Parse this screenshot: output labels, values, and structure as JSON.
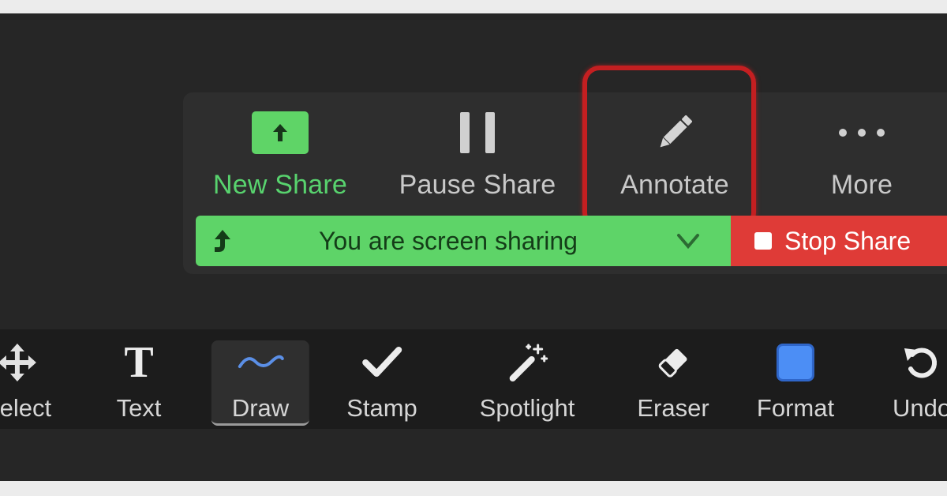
{
  "share_toolbar": {
    "items": [
      {
        "label": "New Share",
        "icon": "share-arrow-up-icon"
      },
      {
        "label": "Pause Share",
        "icon": "pause-icon"
      },
      {
        "label": "Annotate",
        "icon": "pencil-icon"
      },
      {
        "label": "More",
        "icon": "more-dots-icon"
      }
    ],
    "status_text": "You are screen sharing",
    "stop_label": "Stop Share"
  },
  "annotation_toolbar": {
    "tools": [
      {
        "label": "Select",
        "icon": "move-arrows-icon"
      },
      {
        "label": "Text",
        "icon": "text-t-icon"
      },
      {
        "label": "Draw",
        "icon": "squiggle-line-icon",
        "selected": true
      },
      {
        "label": "Stamp",
        "icon": "checkmark-icon"
      },
      {
        "label": "Spotlight",
        "icon": "magic-wand-icon"
      },
      {
        "label": "Eraser",
        "icon": "eraser-icon"
      },
      {
        "label": "Format",
        "icon": "color-swatch-icon"
      },
      {
        "label": "Undo",
        "icon": "undo-icon"
      }
    ]
  },
  "colors": {
    "share_green": "#5ed468",
    "stop_red": "#df3b37",
    "highlight_red": "#c41f21",
    "format_blue": "#4c8ef5"
  }
}
